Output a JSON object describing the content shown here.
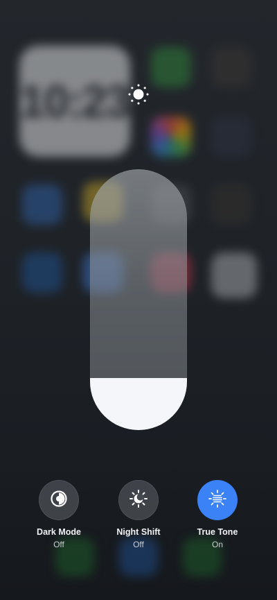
{
  "colors": {
    "accent_on": "#3b82f6",
    "slider_fill": "#f4f6fa"
  },
  "backdrop": {
    "clock_text": "10:23"
  },
  "brightness": {
    "icon": "sun-icon",
    "level_fraction": 0.2
  },
  "controls": [
    {
      "label": "Dark Mode",
      "state": "Off",
      "icon": "dark-mode-icon"
    },
    {
      "label": "Night Shift",
      "state": "Off",
      "icon": "night-shift-icon"
    },
    {
      "label": "True Tone",
      "state": "On",
      "icon": "true-tone-icon"
    }
  ]
}
